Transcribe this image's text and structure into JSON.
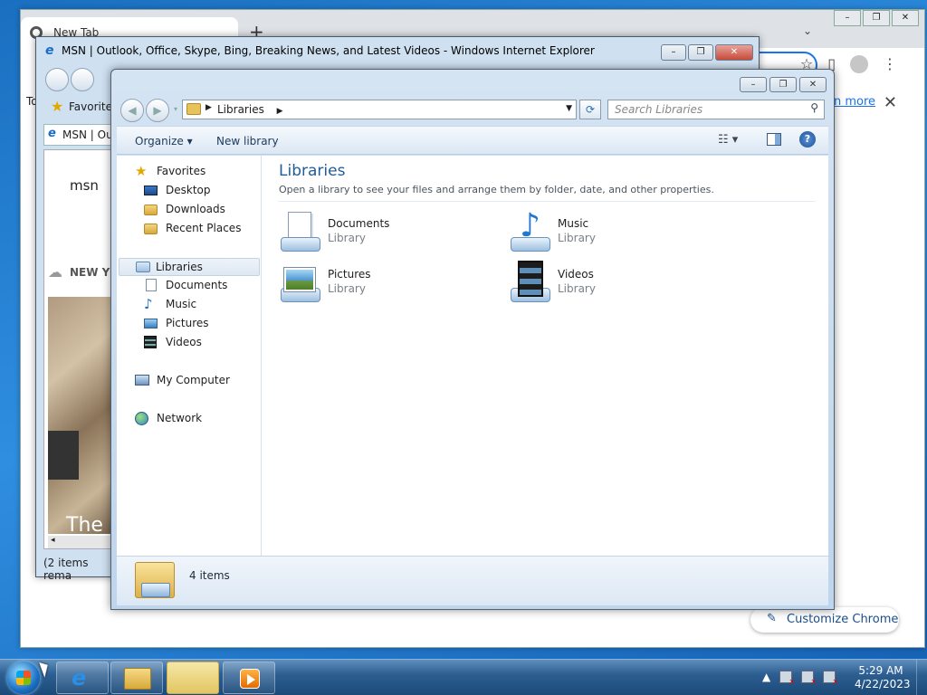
{
  "chrome": {
    "tab_title": "New Tab",
    "new_tab_symbol": "+",
    "chevron": "⌄",
    "banner_left_text": "To",
    "learn_more": "n more",
    "close_symbol": "✕",
    "customize_label": "Customize Chrome",
    "window_buttons": [
      "–",
      "❐",
      "✕"
    ]
  },
  "ie": {
    "title": "MSN | Outlook, Office, Skype, Bing, Breaking News, and Latest Videos - Windows Internet Explorer",
    "favorites_label": "Favorites",
    "tab_label": "MSN | Ou",
    "page": {
      "logo": "msn",
      "weather_text": "NEW Y",
      "headline_fragment": "The"
    },
    "status_text": "(2 items rema",
    "window_buttons": [
      "–",
      "❐",
      "✕"
    ]
  },
  "explorer": {
    "window_buttons": [
      "–",
      "❐",
      "✕"
    ],
    "address": {
      "crumb": "Libraries"
    },
    "search_placeholder": "Search Libraries",
    "commands": {
      "organize": "Organize ▾",
      "new_library": "New library"
    },
    "nav": {
      "favorites": "Favorites",
      "desktop": "Desktop",
      "downloads": "Downloads",
      "recent": "Recent Places",
      "libraries": "Libraries",
      "documents": "Documents",
      "music": "Music",
      "pictures": "Pictures",
      "videos": "Videos",
      "computer": "My Computer",
      "network": "Network"
    },
    "heading": "Libraries",
    "subheading": "Open a library to see your files and arrange them by folder, date, and other properties.",
    "items": [
      {
        "name": "Documents",
        "kind": "Library",
        "icon": "documents-library-icon"
      },
      {
        "name": "Music",
        "kind": "Library",
        "icon": "music-library-icon"
      },
      {
        "name": "Pictures",
        "kind": "Library",
        "icon": "pictures-library-icon"
      },
      {
        "name": "Videos",
        "kind": "Library",
        "icon": "videos-library-icon"
      }
    ],
    "item_count": "4 items"
  },
  "taskbar": {
    "time": "5:29 AM",
    "date": "4/22/2023",
    "tray_arrow": "▲"
  }
}
